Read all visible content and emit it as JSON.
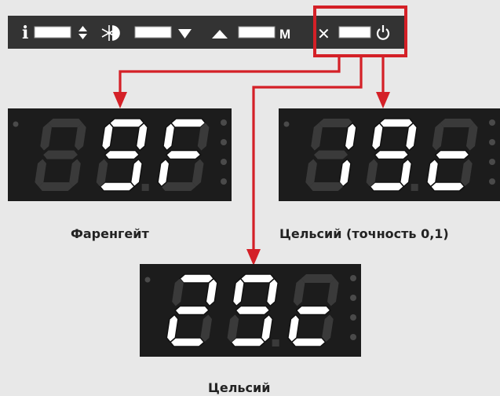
{
  "control_panel": {
    "buttons": [
      {
        "left_icon": "info-icon",
        "right_icon": "up-down-arrows-icon"
      },
      {
        "left_icon": "defrost-snowflake-icon",
        "right_icon": "down-triangle-icon"
      },
      {
        "left_icon": "up-triangle-icon",
        "right_icon": "m-letter-icon"
      },
      {
        "left_icon": "cross-icon",
        "right_icon": "power-icon"
      }
    ],
    "info_glyph": "i",
    "m_glyph": "M",
    "cross_glyph": "✕",
    "highlight_color": "#d42027"
  },
  "displays": [
    {
      "digits": [
        "blank",
        "9",
        "F"
      ],
      "dot_after": 2
    },
    {
      "digits": [
        "blank",
        "1",
        "9",
        "c"
      ],
      "dot_after": 3
    },
    {
      "digits": [
        "2",
        "9",
        "c"
      ],
      "dot_after": 2
    }
  ],
  "captions": {
    "fahrenheit": "Фаренгейт",
    "celsius_precise": "Цельсий (точность 0,1)",
    "celsius": "Цельсий"
  },
  "colors": {
    "panel": "#333333",
    "display_bg": "#1c1c1c",
    "segment_on": "#ffffff",
    "segment_off": "#3a3a3a",
    "arrow": "#d42027"
  }
}
